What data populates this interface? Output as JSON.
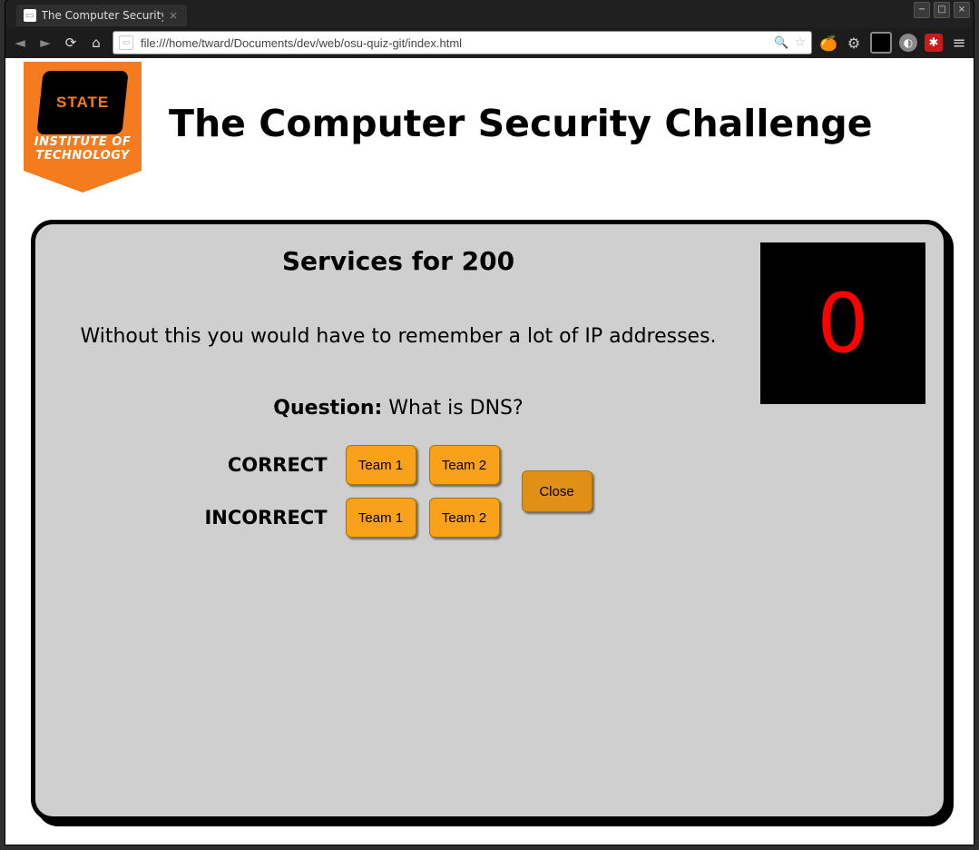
{
  "window": {
    "minimize": "−",
    "maximize": "□",
    "close": "×"
  },
  "browser": {
    "tab_title": "The Computer Security",
    "url": "file:///home/tward/Documents/dev/web/osu-quiz-git/index.html"
  },
  "logo": {
    "state_text": "STATE",
    "institute_line1": "INSTITUTE OF",
    "institute_line2": "TECHNOLOGY"
  },
  "page": {
    "title": "The Computer Security Challenge"
  },
  "quiz": {
    "header": "Services for 200",
    "clue": "Without this you would have to remember a lot of IP addresses.",
    "question_label": "Question:",
    "answer": "What is DNS?",
    "correct_label": "CORRECT",
    "incorrect_label": "INCORRECT",
    "team1_label": "Team 1",
    "team2_label": "Team 2",
    "close_label": "Close",
    "timer": "0"
  }
}
